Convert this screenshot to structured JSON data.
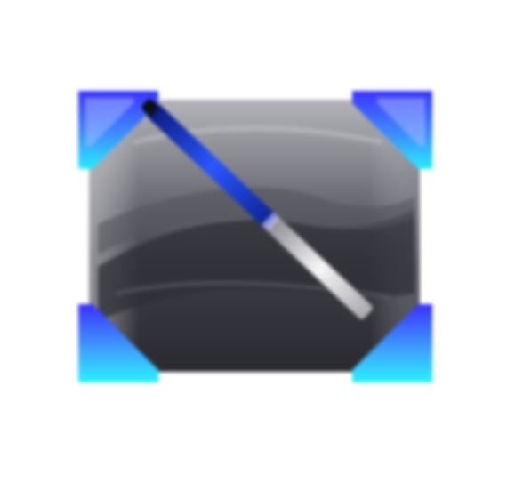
{
  "icon": {
    "name": "screen-edit-icon",
    "colors": {
      "background": "#ffffff",
      "body_light": "#9a9aa0",
      "body_dark": "#2c2c33",
      "corner_blue": "#3b3dff",
      "corner_cyan": "#27e6ff",
      "stylus_blue": "#1430d8",
      "stylus_silver": "#e8e8ea"
    }
  }
}
